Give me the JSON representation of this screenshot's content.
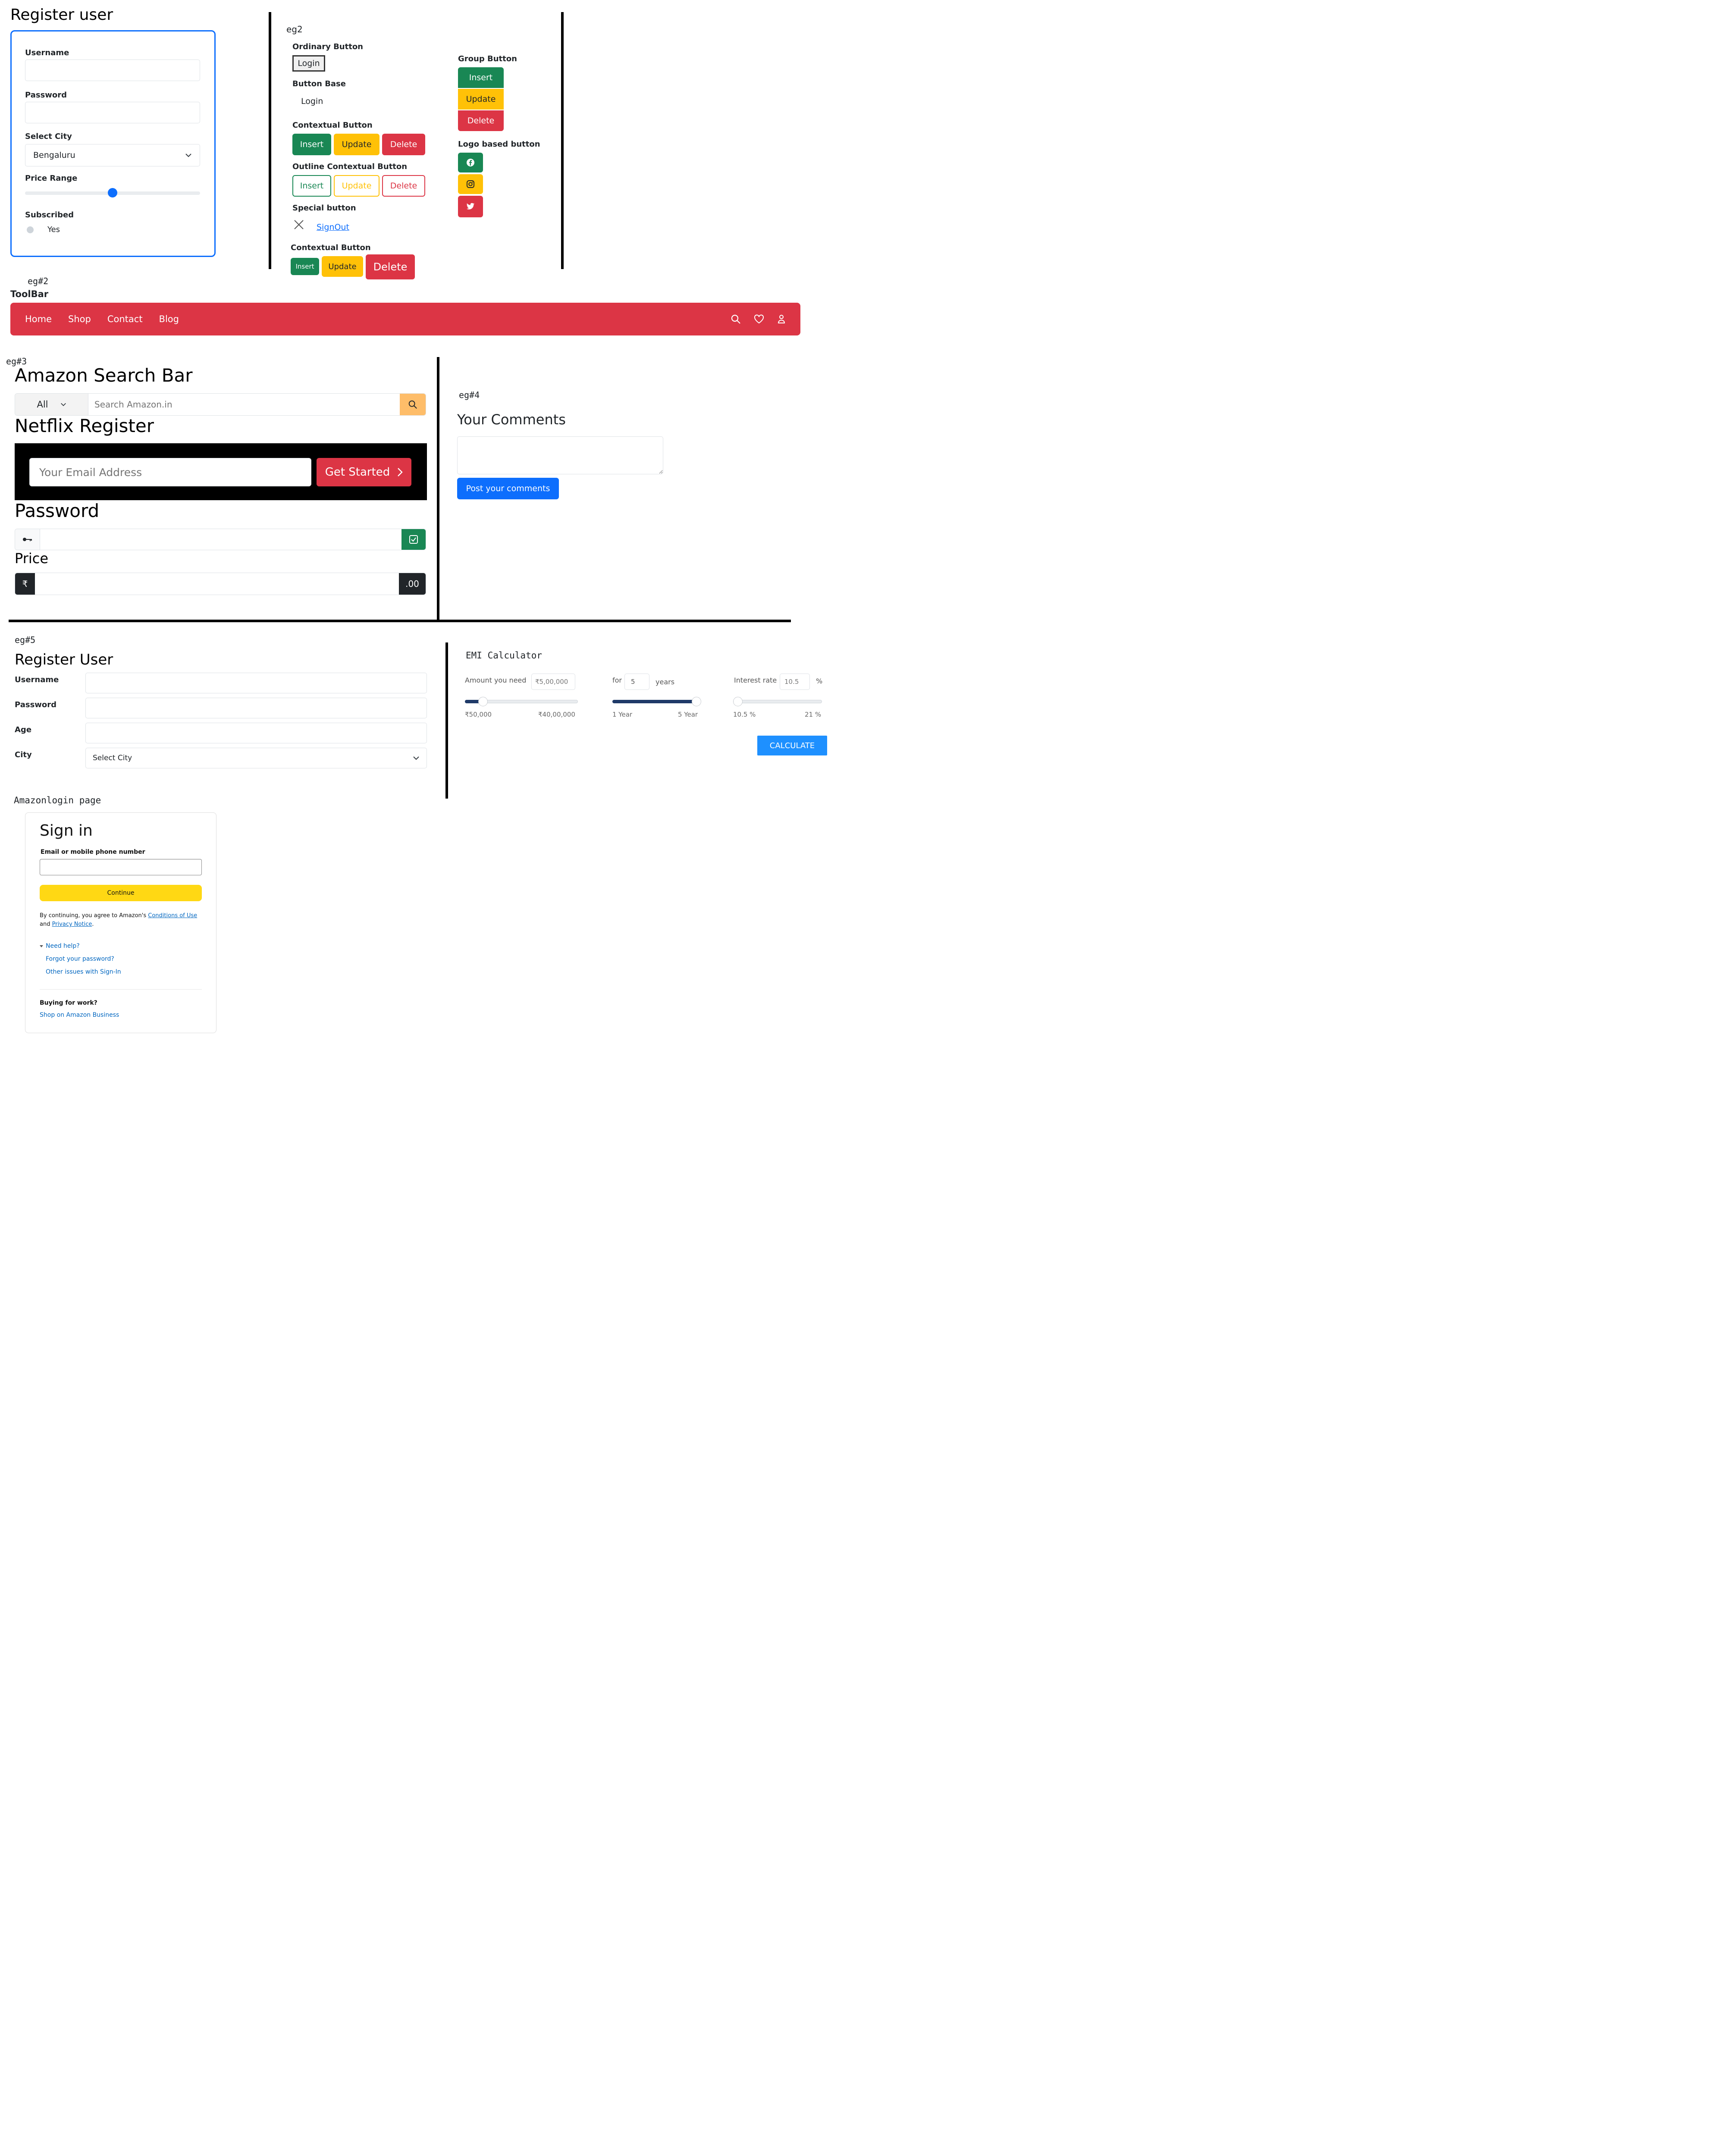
{
  "reg1": {
    "title": "Register user",
    "username_label": "Username",
    "password_label": "Password",
    "city_label": "Select City",
    "city_value": "Bengaluru",
    "price_label": "Price Range",
    "price_fraction": 0.5,
    "subscribed_label": "Subscribed",
    "subscribed_option": "Yes"
  },
  "eg2": {
    "tag": "eg2",
    "ordinary_label": "Ordinary Button",
    "ordinary_btn": "Login",
    "base_label": "Button Base",
    "base_btn": "Login",
    "contextual_label": "Contextual Button",
    "insert": "Insert",
    "update": "Update",
    "delete": "Delete",
    "outline_label": "Outline Contextual Button",
    "special_label": "Special button",
    "signout": "SignOut",
    "contextual2_label": "Contextual Button",
    "group_label": "Group Button",
    "logo_label": "Logo based button",
    "logo_icons": [
      "facebook-icon",
      "instagram-icon",
      "twitter-icon"
    ]
  },
  "toolbar": {
    "tag": "eg#2",
    "title": "ToolBar",
    "links": [
      "Home",
      "Shop",
      "Contact",
      "Blog"
    ],
    "icons": [
      "search-icon",
      "heart-icon",
      "user-icon"
    ],
    "color": "#dc3545"
  },
  "eg3": {
    "tag": "eg#3",
    "amazon_title": "Amazon Search Bar",
    "amazon_select": "All",
    "amazon_placeholder": "Search Amazon.in",
    "netflix_title": "Netflix Register",
    "netflix_placeholder": "Your Email Address",
    "netflix_btn": "Get Started",
    "password_title": "Password",
    "price_title": "Price",
    "rupee": "₹",
    "decimals": ".00"
  },
  "eg4": {
    "tag": "eg#4",
    "title": "Your Comments",
    "btn": "Post your comments",
    "btn_color": "#0d6efd"
  },
  "eg5": {
    "tag": "eg#5",
    "title": "Register User",
    "username": "Username",
    "password": "Password",
    "age": "Age",
    "city": "City",
    "city_placeholder": "Select City"
  },
  "emi": {
    "title": "EMI Calculator",
    "amount_label": "Amount you need",
    "amount_value": "₹5,00,000",
    "amount_min": "₹50,000",
    "amount_max": "₹40,00,000",
    "amount_fraction": 0.13,
    "for_label": "for",
    "years_value": "5",
    "years_label": "years",
    "years_min": "1 Year",
    "years_max": "5 Year",
    "years_fraction": 1.0,
    "interest_label": "Interest rate",
    "interest_value": "10.5",
    "interest_unit": "%",
    "interest_min": "10.5 %",
    "interest_max": "21 %",
    "interest_fraction": 0.0,
    "calculate": "CALCULATE",
    "calculate_color": "#1e90ff"
  },
  "amazon_login": {
    "tag": "Amazonlogin page",
    "title": "Sign in",
    "email_label": "Email or mobile phone number",
    "continue": "Continue",
    "terms_prefix": "By continuing, you agree to Amazon's",
    "terms_conditions": "Conditions of Use",
    "terms_and": "and",
    "terms_privacy": "Privacy Notice",
    "terms_end": ".",
    "need_help": "Need help?",
    "forgot": "Forgot your password?",
    "other_issues": "Other issues with Sign-In",
    "buying": "Buying for work?",
    "business": "Shop on Amazon Business",
    "continue_color": "#ffd814"
  }
}
